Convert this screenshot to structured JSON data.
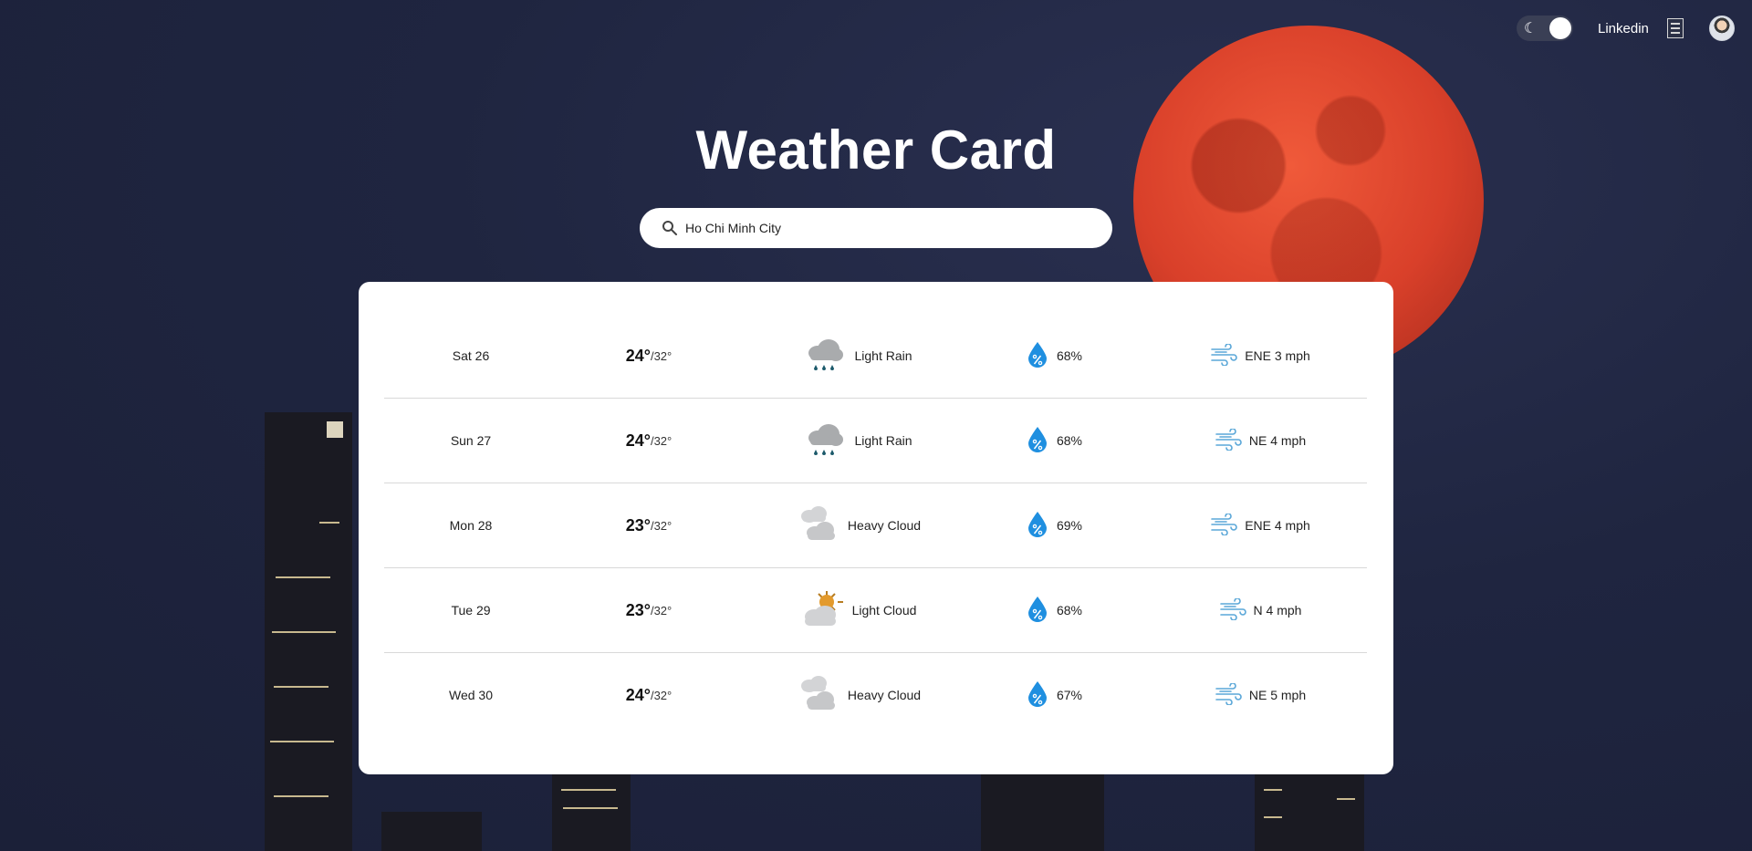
{
  "header": {
    "toggle_icon": "moon-icon",
    "link_label": "Linkedin",
    "news_icon": "newspaper-icon",
    "avatar_icon": "user-avatar"
  },
  "title": "Weather Card",
  "search": {
    "value": "Ho Chi Minh City",
    "icon": "search-icon"
  },
  "forecast": [
    {
      "day": "Sat 26",
      "hi": "24°",
      "lo": "/32°",
      "condition": "Light Rain",
      "icon": "rain-cloud-icon",
      "humidity": "68%",
      "wind": "ENE 3 mph"
    },
    {
      "day": "Sun 27",
      "hi": "24°",
      "lo": "/32°",
      "condition": "Light Rain",
      "icon": "rain-cloud-icon",
      "humidity": "68%",
      "wind": "NE 4 mph"
    },
    {
      "day": "Mon 28",
      "hi": "23°",
      "lo": "/32°",
      "condition": "Heavy Cloud",
      "icon": "heavy-cloud-icon",
      "humidity": "69%",
      "wind": "ENE 4 mph"
    },
    {
      "day": "Tue 29",
      "hi": "23°",
      "lo": "/32°",
      "condition": "Light Cloud",
      "icon": "sun-cloud-icon",
      "humidity": "68%",
      "wind": "N 4 mph"
    },
    {
      "day": "Wed 30",
      "hi": "24°",
      "lo": "/32°",
      "condition": "Heavy Cloud",
      "icon": "heavy-cloud-icon",
      "humidity": "67%",
      "wind": "NE 5 mph"
    }
  ],
  "colors": {
    "accent_blue": "#1f8fe0",
    "cloud_gray": "#a9abad",
    "sun_orange": "#e39a2c",
    "background": "#1f2540"
  }
}
